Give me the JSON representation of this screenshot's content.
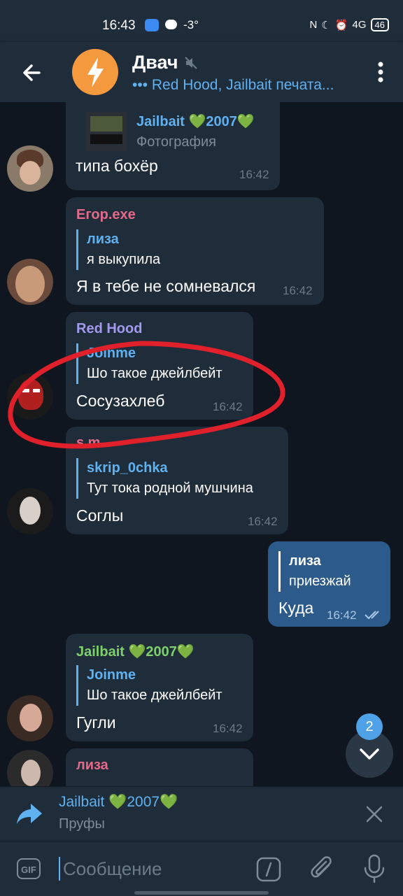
{
  "status": {
    "time": "16:43",
    "temp": "-3°",
    "network": "4G",
    "battery": "46"
  },
  "header": {
    "title": "Двач",
    "subtitle": "••• Red Hood, Jailbait печата..."
  },
  "messages": [
    {
      "reply_name": "Jailbait 💚2007💚",
      "reply_text": "Фотография",
      "text": "типа бохёр",
      "time": "16:42"
    },
    {
      "sender": "Егор.exe",
      "reply_name": "лиза",
      "reply_text": "я выкупила",
      "text": "Я в тебе не сомневался",
      "time": "16:42"
    },
    {
      "sender": "Red Hood",
      "reply_name": "Joinme",
      "reply_text": "Шо такое джейлбейт",
      "text": "Сосузахлеб",
      "time": "16:42"
    },
    {
      "sender": "s.m",
      "reply_name": "skrip_0chka",
      "reply_text": "Тут тока родной мушчина",
      "text": "Соглы",
      "time": "16:42"
    },
    {
      "reply_name": "лиза",
      "reply_text": "приезжай",
      "text": "Куда",
      "time": "16:42"
    },
    {
      "sender": "Jailbait 💚2007💚",
      "reply_name": "Joinme",
      "reply_text": "Шо такое джейлбейт",
      "text": "Гугли",
      "time": "16:42"
    },
    {
      "sender": "лиза"
    }
  ],
  "colors": {
    "egor": "#e56a8a",
    "redhood": "#a39af0",
    "sm": "#e56a8a",
    "jailbait": "#7ed06a",
    "liza": "#e56a8a",
    "accent": "#5fb1f0"
  },
  "scroll_badge": "2",
  "reply_bar": {
    "name": "Jailbait 💚2007💚",
    "text": "Пруфы"
  },
  "input": {
    "placeholder": "Сообщение",
    "gif_label": "GIF"
  }
}
